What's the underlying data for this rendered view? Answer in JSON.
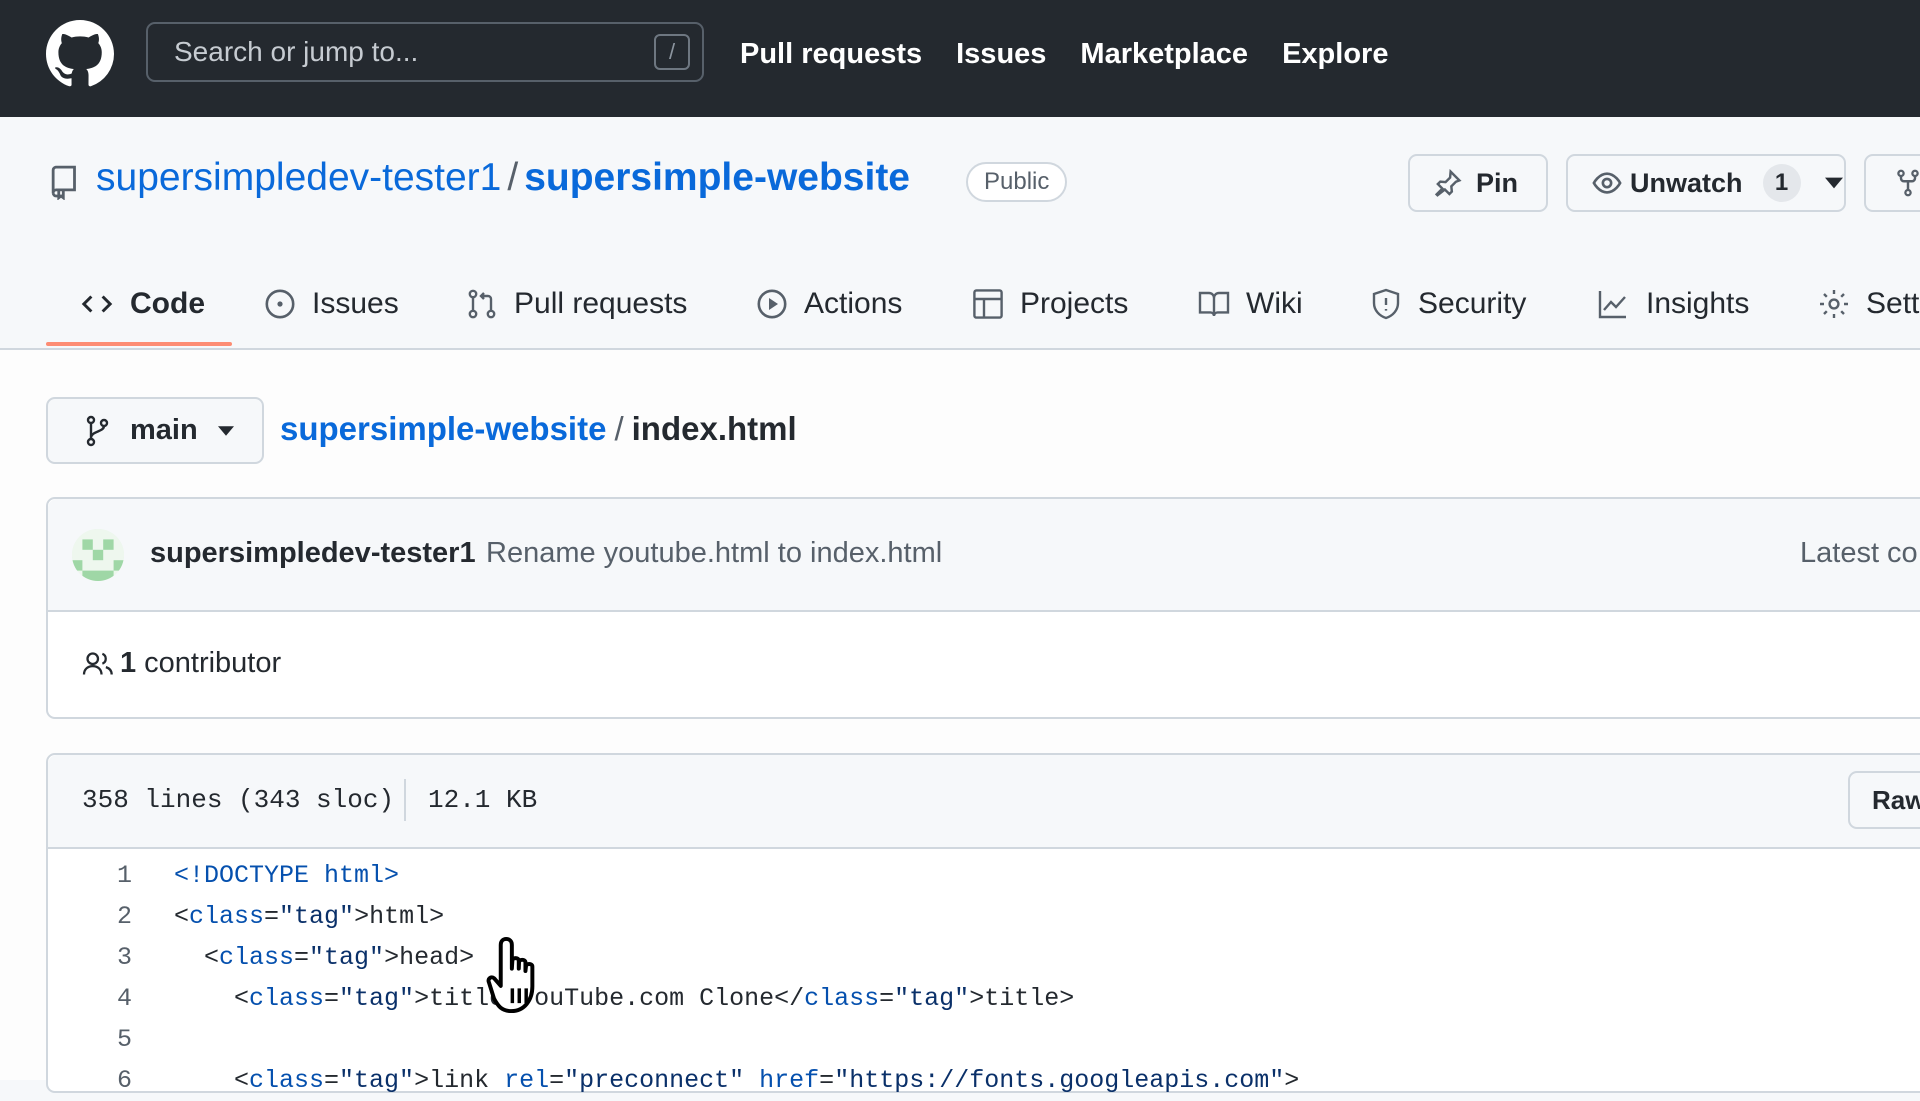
{
  "header": {
    "search_placeholder": "Search or jump to...",
    "search_shortcut": "/",
    "nav": [
      "Pull requests",
      "Issues",
      "Marketplace",
      "Explore"
    ]
  },
  "repo": {
    "owner": "supersimpledev-tester1",
    "separator": "/",
    "name": "supersimple-website",
    "visibility": "Public",
    "pin_label": "Pin",
    "watch_label": "Unwatch",
    "watch_count": "1"
  },
  "tabs": [
    {
      "label": "Code",
      "icon": "code-icon",
      "active": true
    },
    {
      "label": "Issues",
      "icon": "issue-opened-icon"
    },
    {
      "label": "Pull requests",
      "icon": "git-pull-request-icon"
    },
    {
      "label": "Actions",
      "icon": "play-icon"
    },
    {
      "label": "Projects",
      "icon": "table-icon"
    },
    {
      "label": "Wiki",
      "icon": "book-icon"
    },
    {
      "label": "Security",
      "icon": "shield-icon"
    },
    {
      "label": "Insights",
      "icon": "graph-icon"
    },
    {
      "label": "Sett",
      "icon": "gear-icon"
    }
  ],
  "file": {
    "branch": "main",
    "breadcrumb_repo": "supersimple-website",
    "breadcrumb_sep": "/",
    "filename": "index.html"
  },
  "commit": {
    "author": "supersimpledev-tester1",
    "message": "Rename youtube.html to index.html",
    "latest": "Latest co",
    "contributor_count": "1",
    "contributor_label": "contributor"
  },
  "code_header": {
    "lines_info": "358 lines (343 sloc)",
    "size": "12.1 KB",
    "raw_label": "Raw"
  },
  "code": [
    {
      "n": "1",
      "text": "<!DOCTYPE html>"
    },
    {
      "n": "2",
      "text": "<html>"
    },
    {
      "n": "3",
      "text": "  <head>"
    },
    {
      "n": "4",
      "text": "    <title>YouTube.com Clone</title>"
    },
    {
      "n": "5",
      "text": ""
    },
    {
      "n": "6",
      "text": "    <link rel=\"preconnect\" href=\"https://fonts.googleapis.com\">"
    }
  ],
  "colors": {
    "topbar": "#24292f",
    "link": "#0969da",
    "active_tab_underline": "#fd8c73"
  }
}
